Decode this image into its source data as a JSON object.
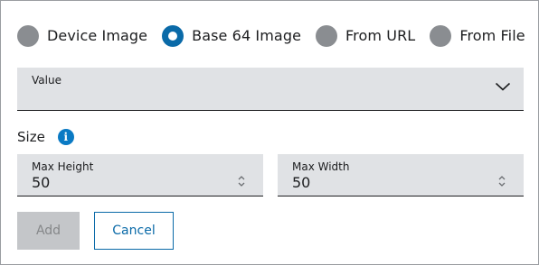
{
  "image_source": {
    "options": [
      {
        "label": "Device Image",
        "checked": false
      },
      {
        "label": "Base 64 Image",
        "checked": true
      },
      {
        "label": "From URL",
        "checked": false
      },
      {
        "label": "From File",
        "checked": false
      }
    ]
  },
  "value_select": {
    "label": "Value",
    "selected": ""
  },
  "size": {
    "label": "Size",
    "info_icon": "info-icon",
    "max_height": {
      "label": "Max Height",
      "value": "50"
    },
    "max_width": {
      "label": "Max Width",
      "value": "50"
    }
  },
  "actions": {
    "add_label": "Add",
    "cancel_label": "Cancel"
  },
  "colors": {
    "accent": "#0a6aa8",
    "field_bg": "#e0e2e5",
    "radio_unchecked": "#8a8d91",
    "disabled_bg": "#c4c6c9"
  }
}
